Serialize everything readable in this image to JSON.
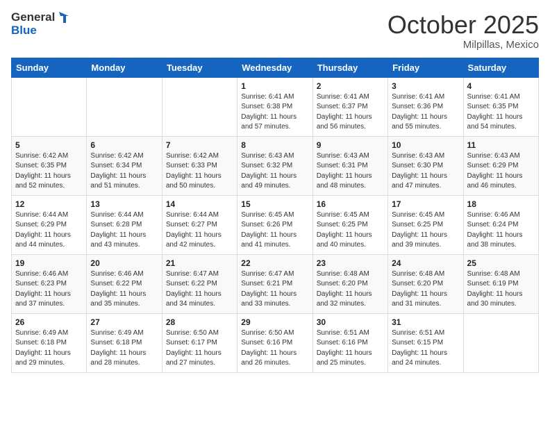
{
  "header": {
    "logo_general": "General",
    "logo_blue": "Blue",
    "month": "October 2025",
    "location": "Milpillas, Mexico"
  },
  "days_of_week": [
    "Sunday",
    "Monday",
    "Tuesday",
    "Wednesday",
    "Thursday",
    "Friday",
    "Saturday"
  ],
  "weeks": [
    [
      {
        "day": "",
        "sunrise": "",
        "sunset": "",
        "daylight": ""
      },
      {
        "day": "",
        "sunrise": "",
        "sunset": "",
        "daylight": ""
      },
      {
        "day": "",
        "sunrise": "",
        "sunset": "",
        "daylight": ""
      },
      {
        "day": "1",
        "sunrise": "Sunrise: 6:41 AM",
        "sunset": "Sunset: 6:38 PM",
        "daylight": "Daylight: 11 hours and 57 minutes."
      },
      {
        "day": "2",
        "sunrise": "Sunrise: 6:41 AM",
        "sunset": "Sunset: 6:37 PM",
        "daylight": "Daylight: 11 hours and 56 minutes."
      },
      {
        "day": "3",
        "sunrise": "Sunrise: 6:41 AM",
        "sunset": "Sunset: 6:36 PM",
        "daylight": "Daylight: 11 hours and 55 minutes."
      },
      {
        "day": "4",
        "sunrise": "Sunrise: 6:41 AM",
        "sunset": "Sunset: 6:35 PM",
        "daylight": "Daylight: 11 hours and 54 minutes."
      }
    ],
    [
      {
        "day": "5",
        "sunrise": "Sunrise: 6:42 AM",
        "sunset": "Sunset: 6:35 PM",
        "daylight": "Daylight: 11 hours and 52 minutes."
      },
      {
        "day": "6",
        "sunrise": "Sunrise: 6:42 AM",
        "sunset": "Sunset: 6:34 PM",
        "daylight": "Daylight: 11 hours and 51 minutes."
      },
      {
        "day": "7",
        "sunrise": "Sunrise: 6:42 AM",
        "sunset": "Sunset: 6:33 PM",
        "daylight": "Daylight: 11 hours and 50 minutes."
      },
      {
        "day": "8",
        "sunrise": "Sunrise: 6:43 AM",
        "sunset": "Sunset: 6:32 PM",
        "daylight": "Daylight: 11 hours and 49 minutes."
      },
      {
        "day": "9",
        "sunrise": "Sunrise: 6:43 AM",
        "sunset": "Sunset: 6:31 PM",
        "daylight": "Daylight: 11 hours and 48 minutes."
      },
      {
        "day": "10",
        "sunrise": "Sunrise: 6:43 AM",
        "sunset": "Sunset: 6:30 PM",
        "daylight": "Daylight: 11 hours and 47 minutes."
      },
      {
        "day": "11",
        "sunrise": "Sunrise: 6:43 AM",
        "sunset": "Sunset: 6:29 PM",
        "daylight": "Daylight: 11 hours and 46 minutes."
      }
    ],
    [
      {
        "day": "12",
        "sunrise": "Sunrise: 6:44 AM",
        "sunset": "Sunset: 6:29 PM",
        "daylight": "Daylight: 11 hours and 44 minutes."
      },
      {
        "day": "13",
        "sunrise": "Sunrise: 6:44 AM",
        "sunset": "Sunset: 6:28 PM",
        "daylight": "Daylight: 11 hours and 43 minutes."
      },
      {
        "day": "14",
        "sunrise": "Sunrise: 6:44 AM",
        "sunset": "Sunset: 6:27 PM",
        "daylight": "Daylight: 11 hours and 42 minutes."
      },
      {
        "day": "15",
        "sunrise": "Sunrise: 6:45 AM",
        "sunset": "Sunset: 6:26 PM",
        "daylight": "Daylight: 11 hours and 41 minutes."
      },
      {
        "day": "16",
        "sunrise": "Sunrise: 6:45 AM",
        "sunset": "Sunset: 6:25 PM",
        "daylight": "Daylight: 11 hours and 40 minutes."
      },
      {
        "day": "17",
        "sunrise": "Sunrise: 6:45 AM",
        "sunset": "Sunset: 6:25 PM",
        "daylight": "Daylight: 11 hours and 39 minutes."
      },
      {
        "day": "18",
        "sunrise": "Sunrise: 6:46 AM",
        "sunset": "Sunset: 6:24 PM",
        "daylight": "Daylight: 11 hours and 38 minutes."
      }
    ],
    [
      {
        "day": "19",
        "sunrise": "Sunrise: 6:46 AM",
        "sunset": "Sunset: 6:23 PM",
        "daylight": "Daylight: 11 hours and 37 minutes."
      },
      {
        "day": "20",
        "sunrise": "Sunrise: 6:46 AM",
        "sunset": "Sunset: 6:22 PM",
        "daylight": "Daylight: 11 hours and 35 minutes."
      },
      {
        "day": "21",
        "sunrise": "Sunrise: 6:47 AM",
        "sunset": "Sunset: 6:22 PM",
        "daylight": "Daylight: 11 hours and 34 minutes."
      },
      {
        "day": "22",
        "sunrise": "Sunrise: 6:47 AM",
        "sunset": "Sunset: 6:21 PM",
        "daylight": "Daylight: 11 hours and 33 minutes."
      },
      {
        "day": "23",
        "sunrise": "Sunrise: 6:48 AM",
        "sunset": "Sunset: 6:20 PM",
        "daylight": "Daylight: 11 hours and 32 minutes."
      },
      {
        "day": "24",
        "sunrise": "Sunrise: 6:48 AM",
        "sunset": "Sunset: 6:20 PM",
        "daylight": "Daylight: 11 hours and 31 minutes."
      },
      {
        "day": "25",
        "sunrise": "Sunrise: 6:48 AM",
        "sunset": "Sunset: 6:19 PM",
        "daylight": "Daylight: 11 hours and 30 minutes."
      }
    ],
    [
      {
        "day": "26",
        "sunrise": "Sunrise: 6:49 AM",
        "sunset": "Sunset: 6:18 PM",
        "daylight": "Daylight: 11 hours and 29 minutes."
      },
      {
        "day": "27",
        "sunrise": "Sunrise: 6:49 AM",
        "sunset": "Sunset: 6:18 PM",
        "daylight": "Daylight: 11 hours and 28 minutes."
      },
      {
        "day": "28",
        "sunrise": "Sunrise: 6:50 AM",
        "sunset": "Sunset: 6:17 PM",
        "daylight": "Daylight: 11 hours and 27 minutes."
      },
      {
        "day": "29",
        "sunrise": "Sunrise: 6:50 AM",
        "sunset": "Sunset: 6:16 PM",
        "daylight": "Daylight: 11 hours and 26 minutes."
      },
      {
        "day": "30",
        "sunrise": "Sunrise: 6:51 AM",
        "sunset": "Sunset: 6:16 PM",
        "daylight": "Daylight: 11 hours and 25 minutes."
      },
      {
        "day": "31",
        "sunrise": "Sunrise: 6:51 AM",
        "sunset": "Sunset: 6:15 PM",
        "daylight": "Daylight: 11 hours and 24 minutes."
      },
      {
        "day": "",
        "sunrise": "",
        "sunset": "",
        "daylight": ""
      }
    ]
  ]
}
